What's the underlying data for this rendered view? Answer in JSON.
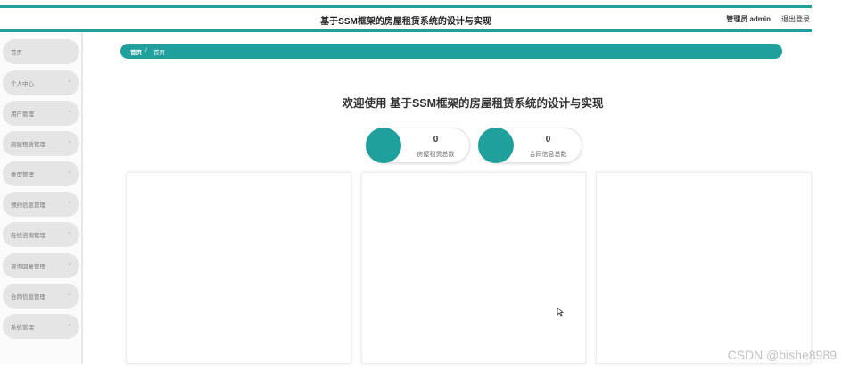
{
  "header": {
    "title": "基于SSM框架的房屋租赁系统的设计与实现",
    "user": "管理员 admin",
    "logout": "退出登录"
  },
  "sidebar": {
    "items": [
      {
        "label": "首页",
        "has_submenu": false
      },
      {
        "label": "个人中心",
        "has_submenu": true
      },
      {
        "label": "用户管理",
        "has_submenu": true
      },
      {
        "label": "房屋租赁管理",
        "has_submenu": true
      },
      {
        "label": "类型管理",
        "has_submenu": true
      },
      {
        "label": "预约信息管理",
        "has_submenu": true
      },
      {
        "label": "在线咨询管理",
        "has_submenu": true
      },
      {
        "label": "咨询回复管理",
        "has_submenu": true
      },
      {
        "label": "合同信息管理",
        "has_submenu": true
      },
      {
        "label": "系统管理",
        "has_submenu": true
      }
    ],
    "chevron": "⌄"
  },
  "breadcrumb": {
    "home": "首页",
    "separator": "/",
    "current": "首页"
  },
  "main": {
    "welcome": "欢迎使用 基于SSM框架的房屋租赁系统的设计与实现",
    "stats": [
      {
        "value": "0",
        "label": "房屋租赁总数"
      },
      {
        "value": "0",
        "label": "合同信息总数"
      }
    ]
  },
  "watermark": "CSDN @bishe8989",
  "colors": {
    "accent": "#1fa09d",
    "sidebar_item_bg": "#e5e5e5"
  }
}
